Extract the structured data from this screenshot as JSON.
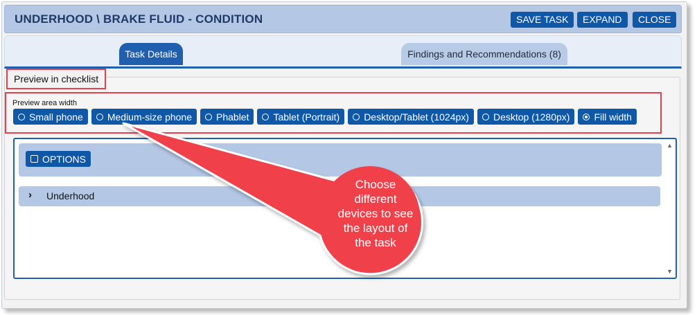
{
  "header": {
    "title": "UNDERHOOD \\ BRAKE FLUID - CONDITION",
    "buttons": {
      "save": "SAVE TASK",
      "expand": "EXPAND",
      "close": "CLOSE"
    }
  },
  "tabs": [
    {
      "label": "Task Details",
      "active": true
    },
    {
      "label": "Findings and Recommendations (8)",
      "active": false
    }
  ],
  "preview": {
    "legend": "Preview in checklist",
    "width_label": "Preview area width",
    "width_options": [
      {
        "label": "Small phone",
        "selected": false
      },
      {
        "label": "Medium-size phone",
        "selected": false
      },
      {
        "label": "Phablet",
        "selected": false
      },
      {
        "label": "Tablet (Portrait)",
        "selected": false
      },
      {
        "label": "Desktop/Tablet (1024px)",
        "selected": false
      },
      {
        "label": "Desktop (1280px)",
        "selected": false
      },
      {
        "label": "Fill width",
        "selected": true
      }
    ],
    "options_button": "OPTIONS",
    "section_label": "Underhood"
  },
  "callout": {
    "text": "Choose\ndifferent\ndevices to see\nthe layout of\nthe task"
  },
  "colors": {
    "accent": "#0f58a8",
    "header_bg": "#b4c8e6",
    "callout": "#f0404a",
    "highlight_border": "#e8404b"
  }
}
